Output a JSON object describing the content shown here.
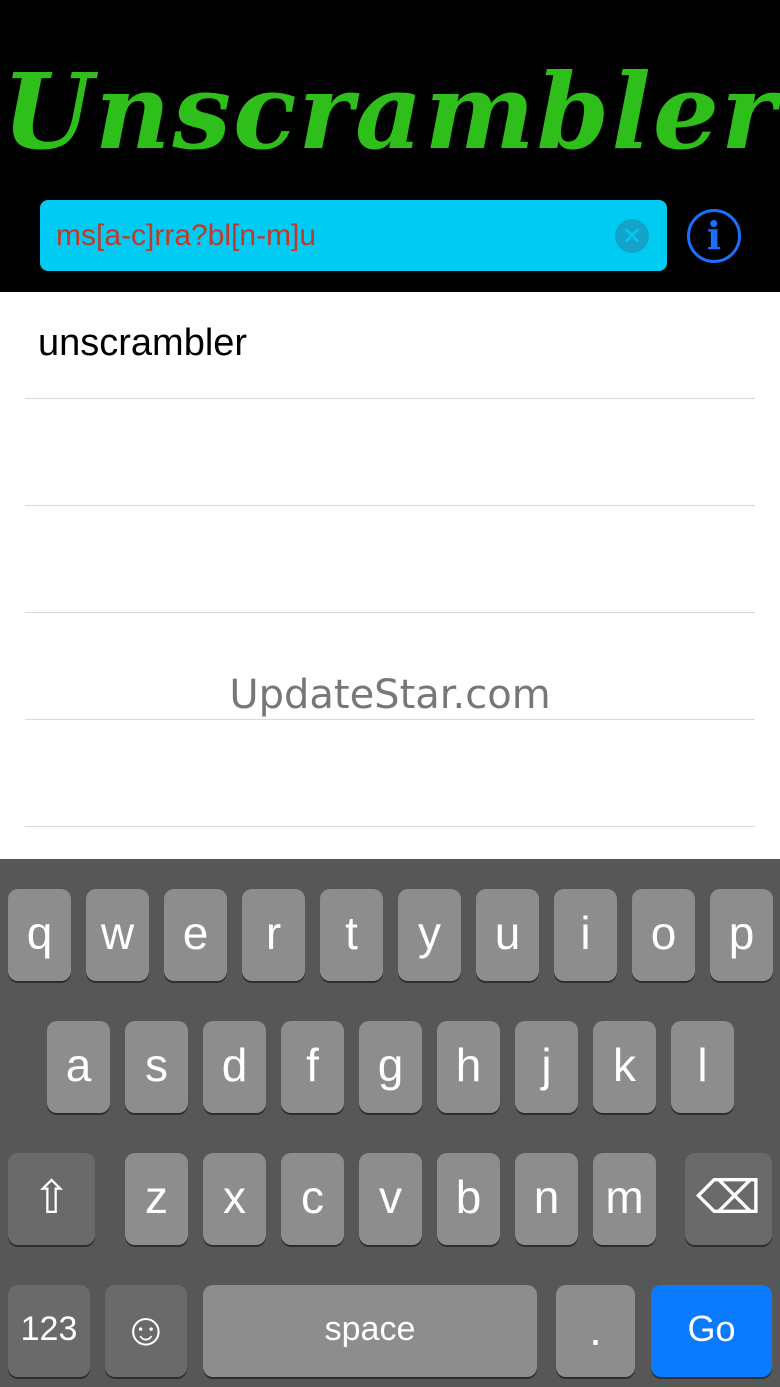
{
  "app": {
    "title": "Unscrambler"
  },
  "search": {
    "value": "ms[a-c]rra?bl[n-m]u",
    "clear_glyph": "✕"
  },
  "info": {
    "glyph": "i"
  },
  "results": {
    "items": [
      "unscrambler",
      "",
      "",
      "",
      ""
    ]
  },
  "watermark": "UpdateStar.com",
  "keyboard": {
    "row1": [
      "q",
      "w",
      "e",
      "r",
      "t",
      "y",
      "u",
      "i",
      "o",
      "p"
    ],
    "row2": [
      "a",
      "s",
      "d",
      "f",
      "g",
      "h",
      "j",
      "k",
      "l"
    ],
    "row3": [
      "z",
      "x",
      "c",
      "v",
      "b",
      "n",
      "m"
    ],
    "shift_glyph": "⇧",
    "delete_glyph": "⌫",
    "numbers_label": "123",
    "emoji_glyph": "☺",
    "space_label": "space",
    "period_label": ".",
    "go_label": "Go"
  },
  "colors": {
    "title_green": "#2fbf1b",
    "search_bg": "#00ccf3",
    "search_text": "#c0392b",
    "info_blue": "#1a6fff",
    "go_blue": "#0a7bff",
    "keyboard_bg": "#575757"
  }
}
